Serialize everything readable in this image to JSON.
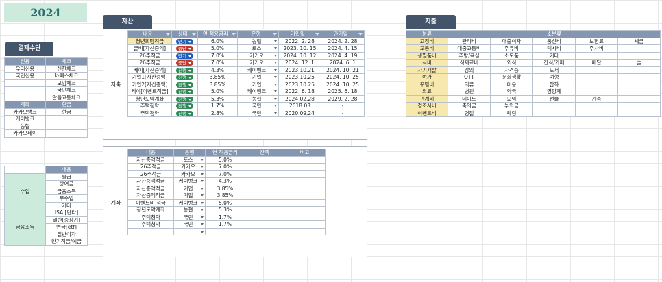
{
  "year": "2024",
  "colors": {
    "tab": "#44546a",
    "header": "#8496b0",
    "progress": "#2e8b57",
    "maturity": "#1f5fbf",
    "stopped": "#c0392b"
  },
  "payment": {
    "tab": "결제수단",
    "headers": [
      "신용",
      "체크"
    ],
    "rows": [
      [
        "우리신용",
        "신한체크"
      ],
      [
        "국민신용",
        "k-패스체크"
      ],
      [
        "",
        "모임체크"
      ],
      [
        "",
        "국민체크"
      ],
      [
        "",
        "알뜰교통체크"
      ]
    ],
    "headers2": [
      "계좌",
      "현금"
    ],
    "rows2": [
      [
        "카카오뱅크",
        "현금"
      ],
      [
        "케이뱅크",
        ""
      ],
      [
        "농협",
        ""
      ],
      [
        "카카오페이",
        ""
      ]
    ]
  },
  "income": {
    "header": "내용",
    "groups": [
      {
        "label": "수입",
        "items": [
          "월급",
          "상여금",
          "금융소득",
          "부수입",
          "기타"
        ]
      },
      {
        "label": "금융소득",
        "items": [
          "ISA [단타]",
          "일반[중장기]",
          "연금[etf]",
          "일반이자",
          "만기적금/예금"
        ]
      }
    ]
  },
  "assets": {
    "tab": "자산",
    "group_label": "저축",
    "headers": [
      "내용",
      "상태",
      "연 적용금리",
      "은행",
      "가입일",
      "만기일"
    ],
    "rows": [
      {
        "name": "청년희망적금",
        "status": "만기",
        "rate": "6.0%",
        "bank": "농협",
        "start": "2022. 2. 28",
        "end": "2024. 2. 28",
        "bold": true
      },
      {
        "name": "굴비[자산증액]",
        "status": "중단",
        "rate": "5.0%",
        "bank": "토스",
        "start": "2023. 10. 15",
        "end": "2024. 4. 15",
        "bold": false
      },
      {
        "name": "26주적금",
        "status": "만기",
        "rate": "7.0%",
        "bank": "카카오",
        "start": "2024. 10. 12",
        "end": "2024. 4. 19",
        "bold": false
      },
      {
        "name": "26주적금",
        "status": "중단",
        "rate": "7.0%",
        "bank": "카카오",
        "start": "2024. 12. 1",
        "end": "2024. 6. 1",
        "bold": false
      },
      {
        "name": "케이[자산증액]",
        "status": "진행",
        "rate": "4.3%",
        "bank": "케이뱅크",
        "start": "2023.10.21",
        "end": "2024. 10. 21",
        "bold": false
      },
      {
        "name": "기업1[자산증액]",
        "status": "진행",
        "rate": "3.85%",
        "bank": "기업",
        "start": "2023.10.25",
        "end": "2024. 10. 25",
        "bold": false
      },
      {
        "name": "기업2[자산증액]",
        "status": "진행",
        "rate": "3.85%",
        "bank": "기업",
        "start": "2023.10.25",
        "end": "2024. 10. 25",
        "bold": false
      },
      {
        "name": "케이[이벤트적금]",
        "status": "진행",
        "rate": "5.0%",
        "bank": "케이뱅크",
        "start": "2022. 6. 18",
        "end": "2025. 6. 18",
        "bold": false
      },
      {
        "name": "청년도약계좌",
        "status": "진행",
        "rate": "5.3%",
        "bank": "농협",
        "start": "2024.02.28",
        "end": "2029. 2. 28",
        "bold": true
      },
      {
        "name": "주택청약",
        "status": "진행",
        "rate": "1.7%",
        "bank": "국민",
        "start": "2018.03",
        "end": "-",
        "bold": true
      },
      {
        "name": "주택청약",
        "status": "진행",
        "rate": "2.8%",
        "bank": "국민",
        "start": "2020.09.24",
        "end": "-",
        "bold": true
      }
    ]
  },
  "accounts": {
    "group_label": "계좌",
    "headers": [
      "내용",
      "은행",
      "연 적용금리",
      "잔액",
      "비고"
    ],
    "rows": [
      {
        "name": "자산증액적금",
        "bank": "토스",
        "rate": "5.0%",
        "bold": false
      },
      {
        "name": "26주적금",
        "bank": "카카오",
        "rate": "7.0%",
        "bold": false
      },
      {
        "name": "26주적금",
        "bank": "카카오",
        "rate": "7.0%",
        "bold": false
      },
      {
        "name": "자산증액적금",
        "bank": "케이뱅크",
        "rate": "4.3%",
        "bold": false
      },
      {
        "name": "자산증액적금",
        "bank": "기업",
        "rate": "3.85%",
        "bold": false
      },
      {
        "name": "자산증액적금",
        "bank": "기업",
        "rate": "3.85%",
        "bold": false
      },
      {
        "name": "이벤트비 적금",
        "bank": "케이뱅크",
        "rate": "5.0%",
        "bold": false
      },
      {
        "name": "청년도약계좌",
        "bank": "농협",
        "rate": "5.3%",
        "bold": true
      },
      {
        "name": "주택청약",
        "bank": "국민",
        "rate": "1.7%",
        "bold": true
      },
      {
        "name": "주택청약",
        "bank": "국민",
        "rate": "1.7%",
        "bold": true
      },
      {
        "name": "",
        "bank": "",
        "rate": "",
        "bold": false
      }
    ]
  },
  "expenses": {
    "tab": "지출",
    "headers": [
      "분류",
      "소분류"
    ],
    "rows": [
      {
        "cat": "고정비",
        "items": [
          "관리비",
          "대출이자",
          "통신비",
          "보험료",
          "세금"
        ]
      },
      {
        "cat": "교통비",
        "items": [
          "대중교통비",
          "주유비",
          "택시비",
          "주차비",
          ""
        ]
      },
      {
        "cat": "생필품비",
        "items": [
          "주방/욕실",
          "소모품",
          "기타",
          "",
          ""
        ]
      },
      {
        "cat": "식비",
        "items": [
          "식재료비",
          "외식",
          "간식/카페",
          "배달",
          "술"
        ]
      },
      {
        "cat": "자기개발",
        "items": [
          "강의",
          "자격증",
          "도서",
          "",
          ""
        ]
      },
      {
        "cat": "여가",
        "items": [
          "OTT",
          "문화생활",
          "여행",
          "",
          ""
        ]
      },
      {
        "cat": "꾸밈비",
        "items": [
          "의류",
          "미용",
          "잡화",
          "",
          ""
        ]
      },
      {
        "cat": "의료",
        "items": [
          "병원",
          "약국",
          "영양제",
          "",
          ""
        ]
      },
      {
        "cat": "관계비",
        "items": [
          "데이트",
          "모임",
          "선물",
          "가족",
          ""
        ]
      },
      {
        "cat": "경조사비",
        "items": [
          "축의금",
          "부의금",
          "",
          "",
          ""
        ]
      },
      {
        "cat": "이벤트비",
        "items": [
          "명절",
          "웨딩",
          "",
          "",
          ""
        ]
      }
    ]
  }
}
